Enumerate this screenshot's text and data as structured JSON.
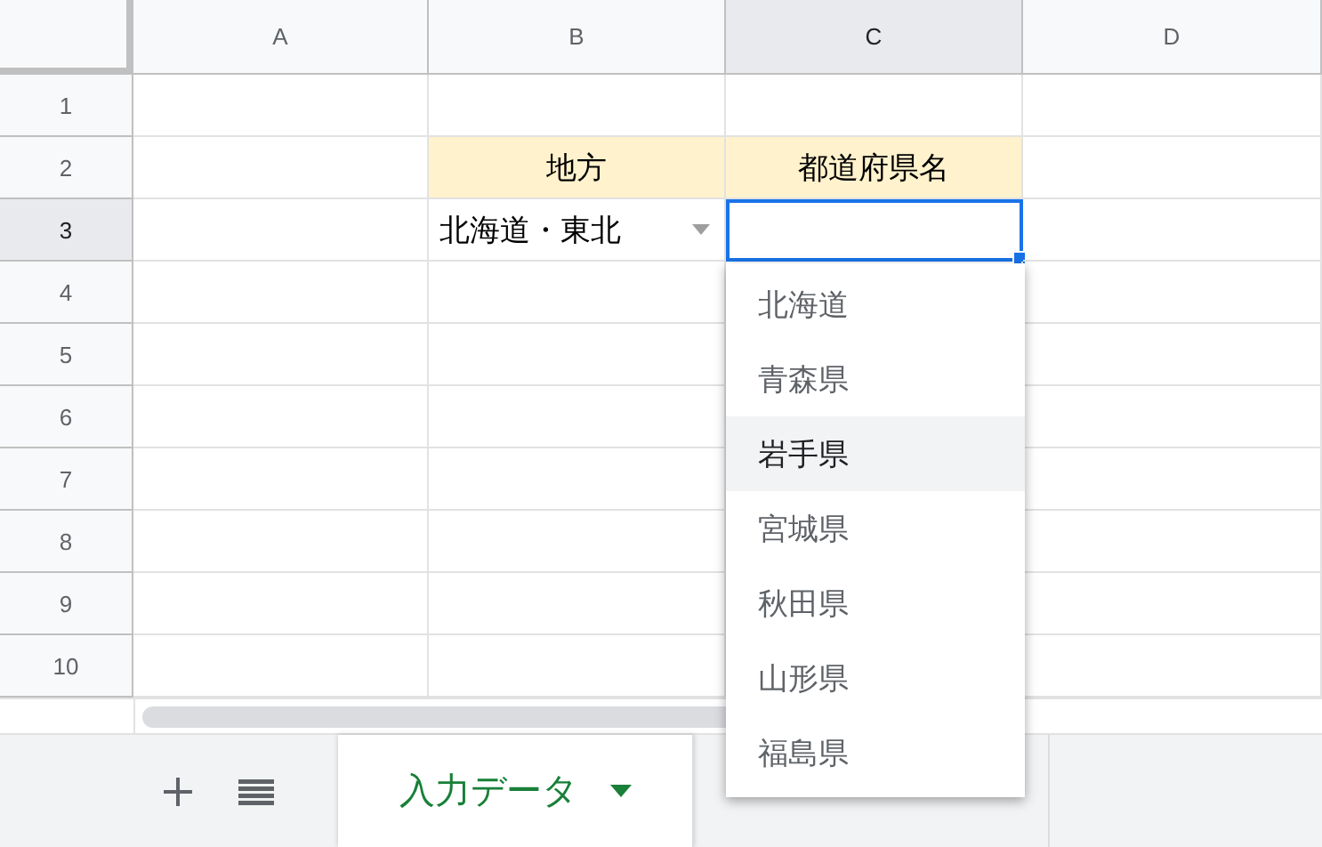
{
  "columns": [
    {
      "label": "A",
      "selected": false
    },
    {
      "label": "B",
      "selected": false
    },
    {
      "label": "C",
      "selected": true
    },
    {
      "label": "D",
      "selected": false
    }
  ],
  "rows": [
    {
      "label": "1",
      "selected": false,
      "cells": [
        {
          "kind": "blank"
        },
        {
          "kind": "blank"
        },
        {
          "kind": "blank"
        },
        {
          "kind": "blank"
        }
      ]
    },
    {
      "label": "2",
      "selected": false,
      "cells": [
        {
          "kind": "blank"
        },
        {
          "kind": "header",
          "text": "地方"
        },
        {
          "kind": "header",
          "text": "都道府県名"
        },
        {
          "kind": "blank"
        }
      ]
    },
    {
      "label": "3",
      "selected": true,
      "cells": [
        {
          "kind": "blank"
        },
        {
          "kind": "dropdown",
          "text": "北海道・東北"
        },
        {
          "kind": "active"
        },
        {
          "kind": "blank"
        }
      ]
    },
    {
      "label": "4",
      "selected": false,
      "cells": [
        {
          "kind": "blank"
        },
        {
          "kind": "blank"
        },
        {
          "kind": "blank"
        },
        {
          "kind": "blank"
        }
      ]
    },
    {
      "label": "5",
      "selected": false,
      "cells": [
        {
          "kind": "blank"
        },
        {
          "kind": "blank"
        },
        {
          "kind": "blank"
        },
        {
          "kind": "blank"
        }
      ]
    },
    {
      "label": "6",
      "selected": false,
      "cells": [
        {
          "kind": "blank"
        },
        {
          "kind": "blank"
        },
        {
          "kind": "blank"
        },
        {
          "kind": "blank"
        }
      ]
    },
    {
      "label": "7",
      "selected": false,
      "cells": [
        {
          "kind": "blank"
        },
        {
          "kind": "blank"
        },
        {
          "kind": "blank"
        },
        {
          "kind": "blank"
        }
      ]
    },
    {
      "label": "8",
      "selected": false,
      "cells": [
        {
          "kind": "blank"
        },
        {
          "kind": "blank"
        },
        {
          "kind": "blank"
        },
        {
          "kind": "blank"
        }
      ]
    },
    {
      "label": "9",
      "selected": false,
      "cells": [
        {
          "kind": "blank"
        },
        {
          "kind": "blank"
        },
        {
          "kind": "blank"
        },
        {
          "kind": "blank"
        }
      ]
    },
    {
      "label": "10",
      "selected": false,
      "cells": [
        {
          "kind": "blank"
        },
        {
          "kind": "blank"
        },
        {
          "kind": "blank"
        },
        {
          "kind": "blank"
        }
      ]
    }
  ],
  "menu": {
    "items": [
      {
        "label": "北海道",
        "selected": false
      },
      {
        "label": "青森県",
        "selected": false
      },
      {
        "label": "岩手県",
        "selected": true
      },
      {
        "label": "宮城県",
        "selected": false
      },
      {
        "label": "秋田県",
        "selected": false
      },
      {
        "label": "山形県",
        "selected": false
      },
      {
        "label": "福島県",
        "selected": false
      }
    ]
  },
  "sheet_tabs": [
    {
      "label": "入力データ",
      "selected": true
    },
    {
      "selected": false
    }
  ]
}
